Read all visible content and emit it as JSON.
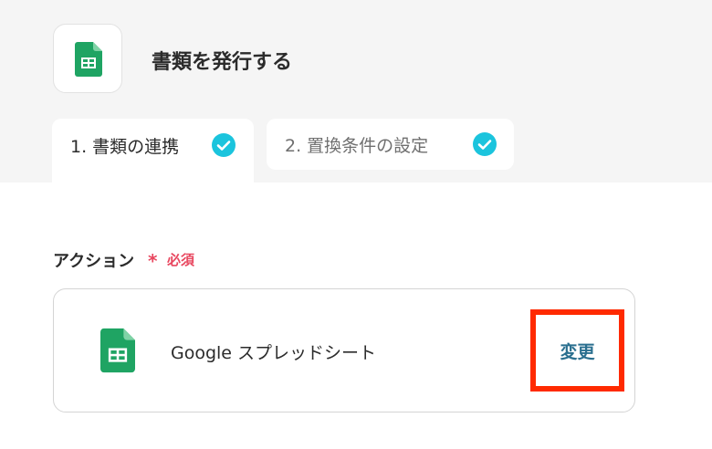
{
  "header": {
    "title": "書類を発行する",
    "app_icon": "google-sheets-icon"
  },
  "tabs": [
    {
      "label": "1. 書類の連携",
      "completed": true,
      "active": true
    },
    {
      "label": "2. 置換条件の設定",
      "completed": true,
      "active": false
    }
  ],
  "action_section": {
    "label": "アクション",
    "required_mark": "*",
    "required_text": "必須"
  },
  "action_card": {
    "app_name": "Google スプレッドシート",
    "app_icon": "google-sheets-icon",
    "change_label": "変更"
  },
  "colors": {
    "sheets_green": "#1fa463",
    "check_cyan": "#1bc4dd",
    "required_red": "#e8475f",
    "link_teal": "#2a6f8f",
    "highlight_red": "#ff2a00",
    "background_gray": "#f5f5f5"
  }
}
